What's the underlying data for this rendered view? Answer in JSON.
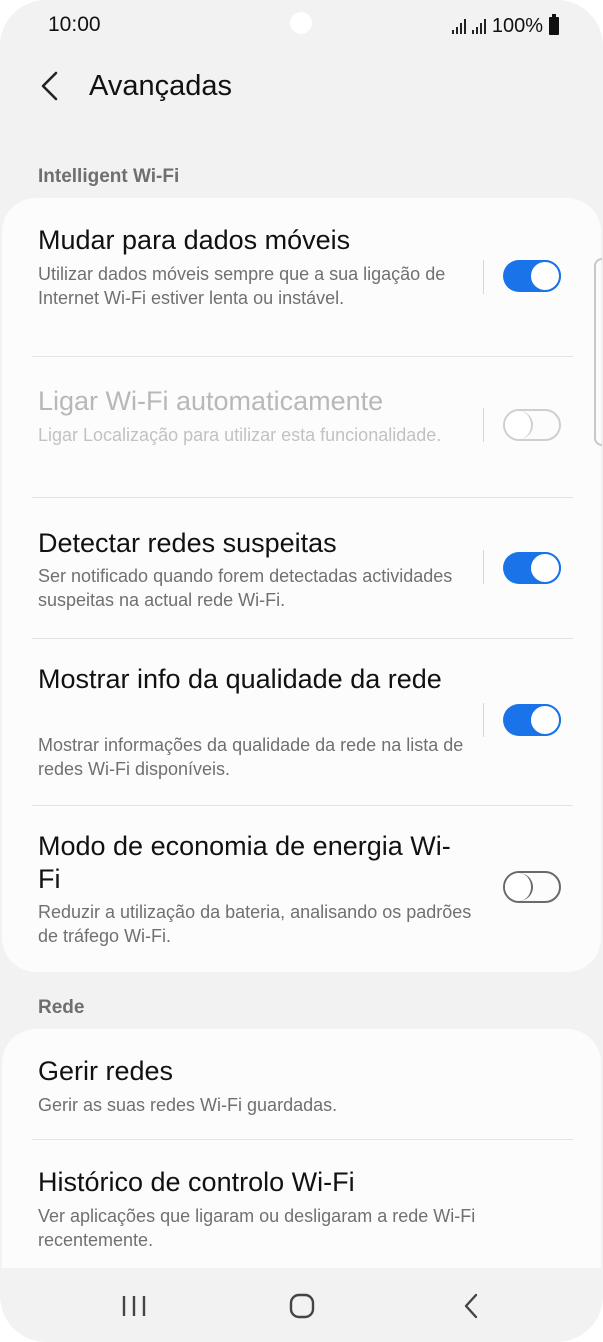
{
  "status": {
    "time": "10:00",
    "battery": "100%"
  },
  "header": {
    "title": "Avançadas"
  },
  "sections": {
    "intelligent": {
      "label": "Intelligent Wi-Fi",
      "items": [
        {
          "title": "Mudar para dados móveis",
          "subtitle": "Utilizar dados móveis sempre que a sua ligação de Internet Wi-Fi estiver lenta ou instável.",
          "toggle": "on"
        },
        {
          "title": "Ligar Wi-Fi automaticamente",
          "subtitle": "Ligar Localização para utilizar esta funcionalidade.",
          "toggle": "off",
          "disabled": true
        },
        {
          "title": "Detectar redes suspeitas",
          "subtitle": "Ser notificado quando forem detectadas actividades suspeitas na actual rede Wi-Fi.",
          "toggle": "on"
        },
        {
          "title": "Mostrar info da qualidade da rede",
          "subtitle": "Mostrar informações da qualidade da rede na lista de redes Wi-Fi disponíveis.",
          "toggle": "on"
        },
        {
          "title": "Modo de economia de energia Wi-Fi",
          "subtitle": "Reduzir a utilização da bateria, analisando os padrões de tráfego Wi-Fi.",
          "toggle": "off"
        }
      ]
    },
    "network": {
      "label": "Rede",
      "items": [
        {
          "title": "Gerir redes",
          "subtitle": "Gerir as suas redes Wi-Fi guardadas."
        },
        {
          "title": "Histórico de controlo Wi-Fi",
          "subtitle": "Ver aplicações que ligaram ou desligaram a rede Wi-Fi recentemente."
        }
      ]
    }
  },
  "nav": {
    "recents_icon": "recents-icon",
    "home_icon": "home-icon",
    "back_icon": "back-icon"
  },
  "colors": {
    "accent": "#1a73e8",
    "background": "#f2f2f2",
    "card": "#fcfcfc"
  }
}
